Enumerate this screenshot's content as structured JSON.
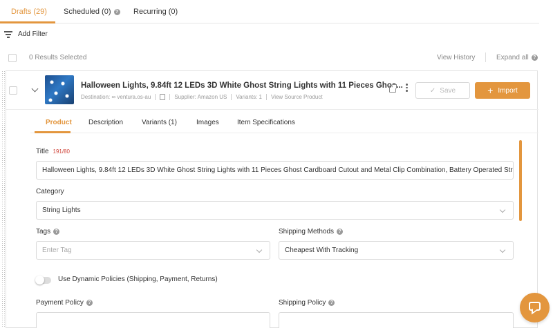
{
  "top_tabs": [
    {
      "label": "Drafts (29)",
      "active": true
    },
    {
      "label": "Scheduled (0)",
      "active": false
    },
    {
      "label": "Recurring (0)",
      "active": false
    }
  ],
  "filter": {
    "label": "Add Filter"
  },
  "results": {
    "selected_text": "0 Results Selected",
    "view_history": "View History",
    "expand_all": "Expand all"
  },
  "item": {
    "title": "Halloween Lights, 9.84ft 12 LEDs 3D White Ghost String Lights with 11 Pieces Ghos...",
    "destination": "Destination: ∞ ventura.os-au",
    "supplier": "Supplier: Amazon US",
    "variants": "Variants: 1",
    "view_source": "View Source Product",
    "save_label": "Save",
    "import_label": "Import"
  },
  "sub_tabs": [
    {
      "label": "Product",
      "active": true
    },
    {
      "label": "Description",
      "active": false
    },
    {
      "label": "Variants (1)",
      "active": false
    },
    {
      "label": "Images",
      "active": false
    },
    {
      "label": "Item Specifications",
      "active": false
    }
  ],
  "form": {
    "title_label": "Title",
    "title_counter": "191/80",
    "title_value": "Halloween Lights, 9.84ft 12 LEDs 3D White Ghost String Lights with 11 Pieces Ghost Cardboard Cutout and Metal Clip Combination, Battery Operated String",
    "category_label": "Category",
    "category_value": "String Lights",
    "tags_label": "Tags",
    "tags_placeholder": "Enter Tag",
    "shipping_methods_label": "Shipping Methods",
    "shipping_methods_value": "Cheapest With Tracking",
    "dynamic_policies_label": "Use Dynamic Policies (Shipping, Payment, Returns)",
    "dynamic_policies_on": false,
    "payment_policy_label": "Payment Policy",
    "shipping_policy_label": "Shipping Policy"
  },
  "colors": {
    "accent": "#e3963e",
    "error": "#d0463b"
  }
}
